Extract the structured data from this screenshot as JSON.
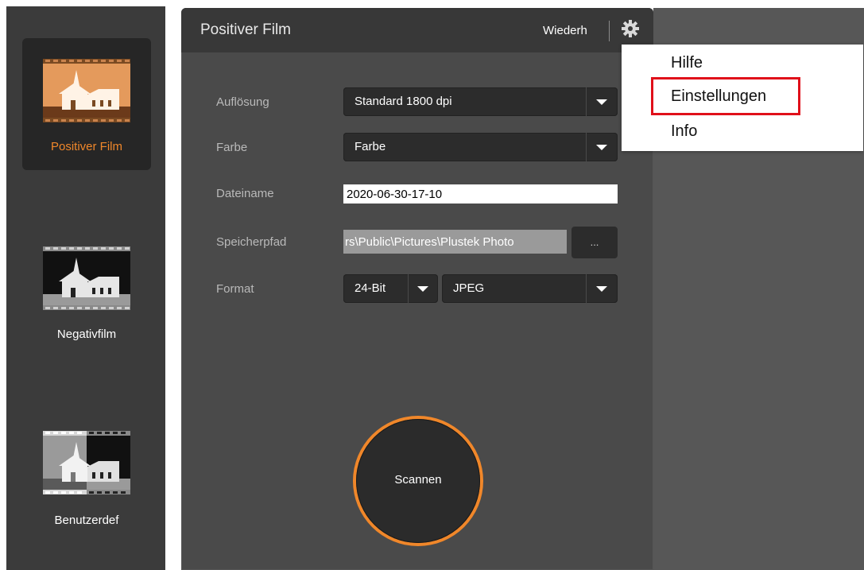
{
  "sidebar": {
    "modes": [
      {
        "label": "Positiver Film",
        "active": true
      },
      {
        "label": "Negativfilm",
        "active": false
      },
      {
        "label": "Benutzerdef",
        "active": false
      }
    ]
  },
  "header": {
    "title": "Positiver Film",
    "reset_label": "Wiederh",
    "settings_icon": "gear-icon"
  },
  "form": {
    "resolution": {
      "label": "Auflösung",
      "value": "Standard 1800 dpi"
    },
    "color": {
      "label": "Farbe",
      "value": "Farbe"
    },
    "filename": {
      "label": "Dateiname",
      "value": "2020-06-30-17-10"
    },
    "save_path": {
      "label": "Speicherpfad",
      "value": "rs\\Public\\Pictures\\Plustek Photo",
      "browse_label": "..."
    },
    "format": {
      "label": "Format",
      "bit_depth": "24-Bit",
      "file_type": "JPEG"
    }
  },
  "scan_button": {
    "label": "Scannen"
  },
  "menu": {
    "items": [
      "Hilfe",
      "Einstellungen",
      "Info"
    ],
    "highlighted_index": 1
  },
  "colors": {
    "accent": "#f0872a",
    "highlight_border": "#e0101a"
  }
}
